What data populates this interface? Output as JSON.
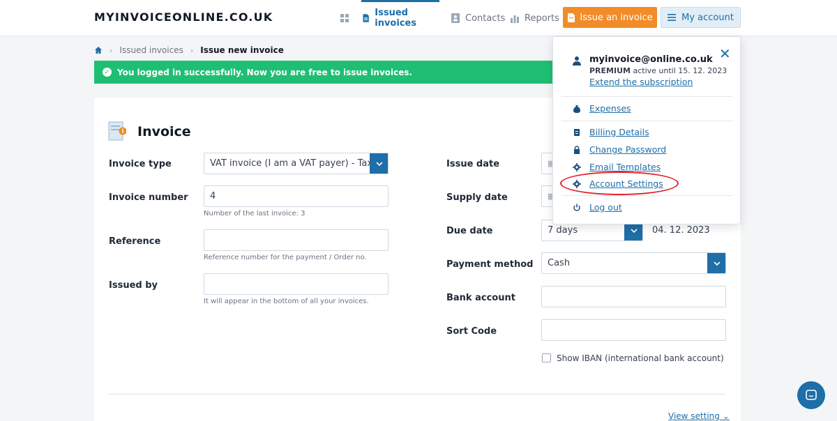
{
  "header": {
    "logo": "MYINVOICEONLINE.CO.UK",
    "nav": {
      "dashboard_icon": "grid-icon",
      "issued": "Issued invoices",
      "contacts": "Contacts",
      "reports": "Reports"
    },
    "issue_button": "Issue an invoice",
    "account_button": "My account"
  },
  "breadcrumb": {
    "home_icon": "home-icon",
    "issued": "Issued invoices",
    "current": "Issue new invoice"
  },
  "alert": {
    "text": "You logged in successfully. Now you are free to issue invoices.",
    "color": "#1ebf73"
  },
  "invoice": {
    "title": "Invoice",
    "invoice_type": {
      "label": "Invoice type",
      "value": "VAT invoice (I am a VAT payer) - Tax d"
    },
    "invoice_number": {
      "label": "Invoice number",
      "value": "4",
      "hint": "Number of the last invoice: 3"
    },
    "reference": {
      "label": "Reference",
      "value": "",
      "hint": "Reference number for the payment / Order no."
    },
    "issued_by": {
      "label": "Issued by",
      "value": "",
      "hint": "It will appear in the bottom of all your invoices."
    },
    "issue_date": {
      "label": "Issue date"
    },
    "supply_date": {
      "label": "Supply date"
    },
    "due_date": {
      "label": "Due date",
      "value": "7 days",
      "computed": "04. 12. 2023"
    },
    "payment_method": {
      "label": "Payment method",
      "value": "Cash"
    },
    "bank_account": {
      "label": "Bank account",
      "value": ""
    },
    "sort_code": {
      "label": "Sort Code",
      "value": ""
    },
    "show_iban": "Show IBAN (international bank account)",
    "view_setting": "View setting"
  },
  "account_menu": {
    "email": "myinvoice@online.co.uk",
    "plan": "PREMIUM",
    "plan_status": "active until 15. 12. 2023",
    "extend": "Extend the subscription",
    "items": {
      "expenses": "Expenses",
      "billing": "Billing Details",
      "password": "Change Password",
      "email_templates": "Email Templates",
      "account_settings": "Account Settings",
      "logout": "Log out"
    }
  },
  "colors": {
    "primary": "#1e6ea7",
    "accent": "#f28c28",
    "highlight": "#e1222a"
  }
}
